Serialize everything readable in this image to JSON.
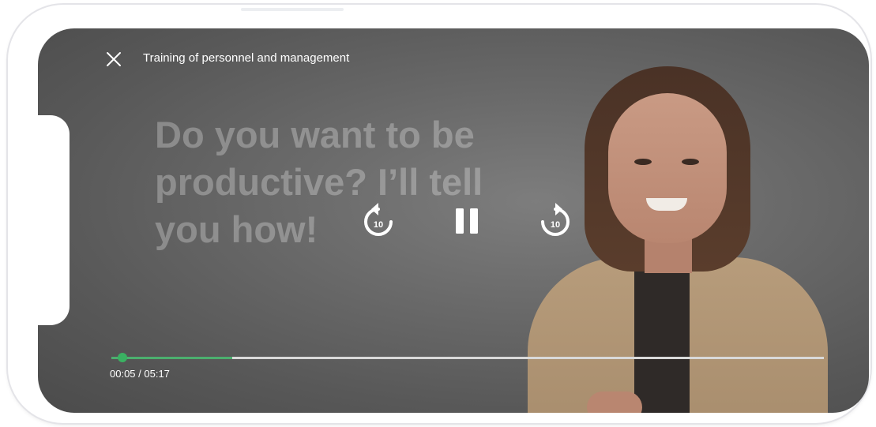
{
  "player": {
    "title": "Training of personnel and management",
    "headline": "Do you want to be productive? I’ll tell you how!",
    "rewind_seconds": "10",
    "forward_seconds": "10",
    "time_display": "00:05 / 05:17",
    "progress_fraction": 0.0158,
    "buffered_fraction": 0.17
  },
  "icons": {
    "close": "close-icon",
    "rewind": "rewind-10-icon",
    "pause": "pause-icon",
    "forward": "forward-10-icon"
  },
  "colors": {
    "accent": "#3ab162",
    "text": "#ffffff"
  }
}
